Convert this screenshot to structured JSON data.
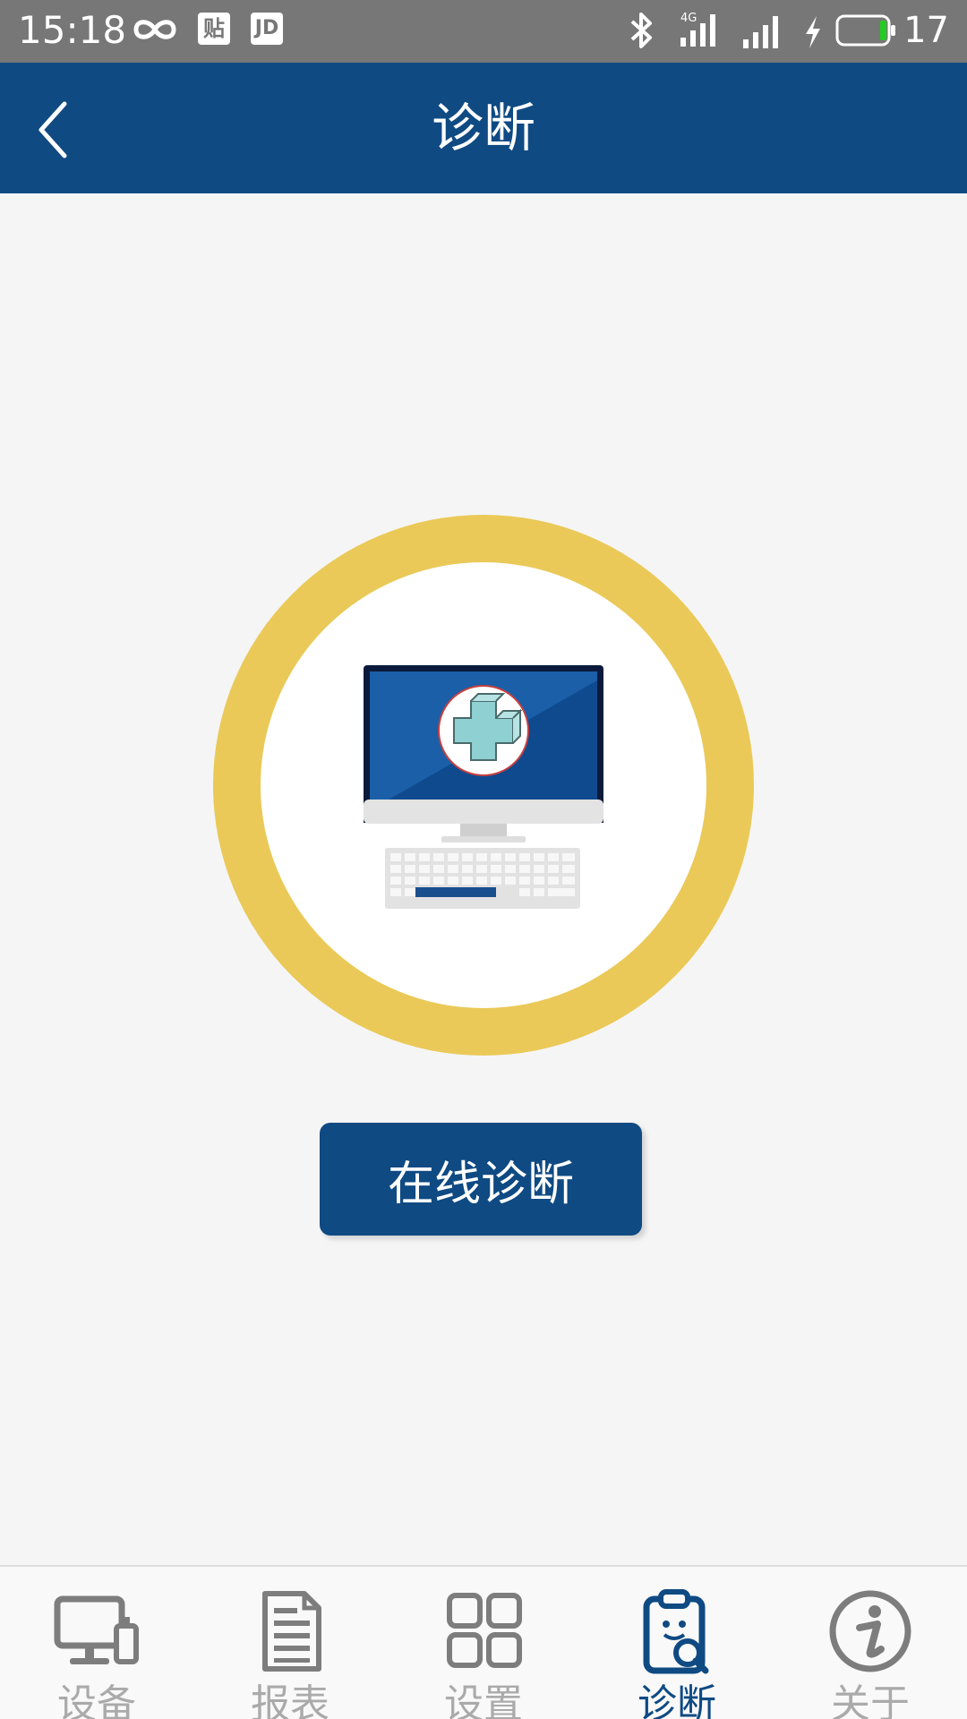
{
  "status_bar": {
    "time": "15:18",
    "badge_tie": "贴",
    "badge_jd": "JD",
    "network_label": "4G",
    "battery_level": "17",
    "icons": [
      "infinity-icon",
      "bluetooth-icon",
      "signal-icon",
      "charging-icon",
      "battery-icon"
    ]
  },
  "header": {
    "title": "诊断",
    "back_icon": "chevron-left-icon"
  },
  "main": {
    "illustration_icon": "computer-diagnosis-icon",
    "action_button_label": "在线诊断"
  },
  "bottom_nav": {
    "items": [
      {
        "label": "设备",
        "icon": "devices-icon"
      },
      {
        "label": "报表",
        "icon": "report-icon"
      },
      {
        "label": "设置",
        "icon": "grid-icon"
      },
      {
        "label": "诊断",
        "icon": "clipboard-search-icon"
      },
      {
        "label": "关于",
        "icon": "info-icon"
      }
    ],
    "active_index": 3
  },
  "colors": {
    "primary": "#0f4a83",
    "accent_ring": "#eac958",
    "status_bar": "#777777",
    "background": "#f5f5f5",
    "nav_inactive": "#aaaaaa",
    "battery_fill": "#22cc22"
  }
}
